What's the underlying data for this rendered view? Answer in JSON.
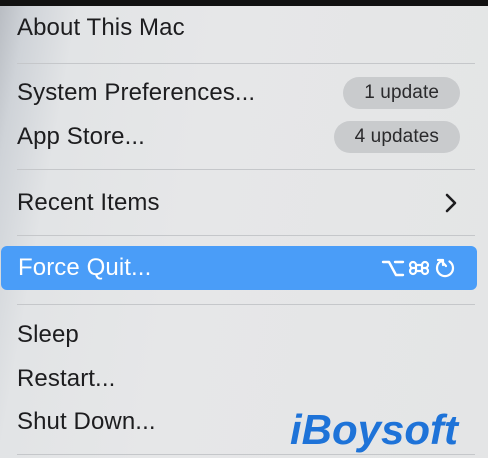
{
  "menu": {
    "about": "About This Mac",
    "system_preferences": {
      "label": "System Preferences...",
      "badge": "1 update"
    },
    "app_store": {
      "label": "App Store...",
      "badge": "4 updates"
    },
    "recent_items": {
      "label": "Recent Items",
      "icon": "chevron-right-icon"
    },
    "force_quit": {
      "label": "Force Quit...",
      "shortcut_icons": [
        "option-key-icon",
        "command-key-icon",
        "escape-key-icon"
      ]
    },
    "sleep": "Sleep",
    "restart": "Restart...",
    "shut_down": "Shut Down..."
  },
  "watermark": {
    "text": "iBoysoft"
  },
  "colors": {
    "highlight": "#4a9df8",
    "watermark": "#1e73d8",
    "badge_bg": "#c9cbcd"
  }
}
